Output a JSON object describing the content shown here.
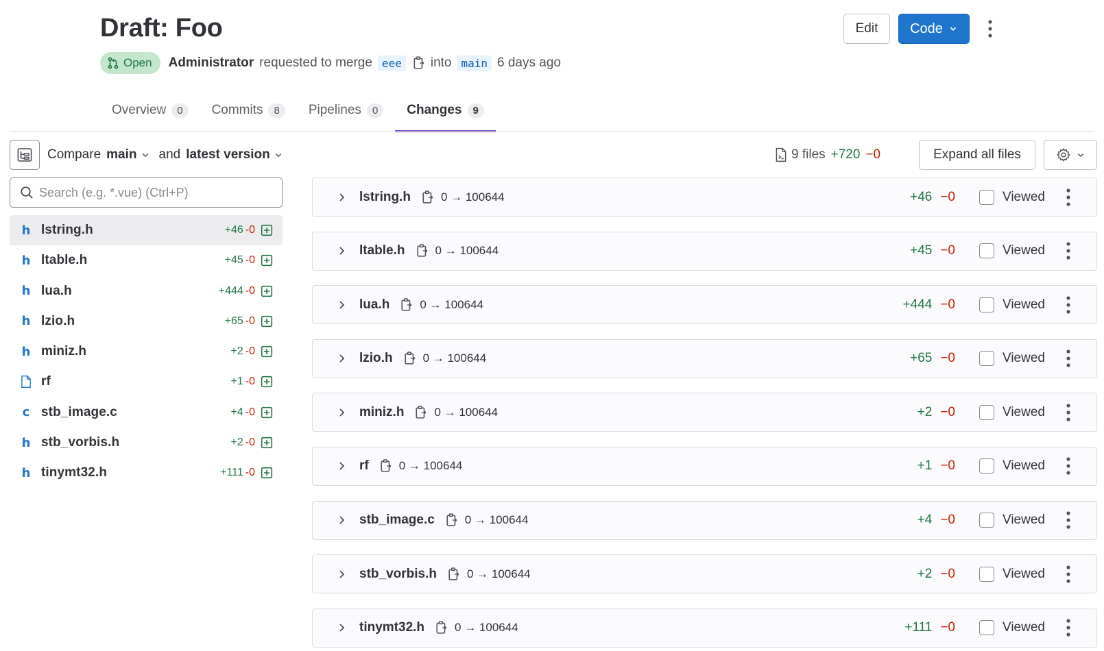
{
  "header": {
    "title": "Draft: Foo",
    "status": "Open",
    "author": "Administrator",
    "action": "requested to merge",
    "source_branch": "eee",
    "into": "into",
    "target_branch": "main",
    "time": "6 days ago",
    "edit_label": "Edit",
    "code_label": "Code"
  },
  "tabs": [
    {
      "label": "Overview",
      "count": "0"
    },
    {
      "label": "Commits",
      "count": "8"
    },
    {
      "label": "Pipelines",
      "count": "0"
    },
    {
      "label": "Changes",
      "count": "9"
    }
  ],
  "toolbar": {
    "compare_label": "Compare",
    "base": "main",
    "and_label": "and",
    "head": "latest version",
    "files_count": "9 files",
    "added_total": "+720",
    "removed_total": "−0",
    "expand_label": "Expand all files"
  },
  "search": {
    "placeholder": "Search (e.g. *.vue) (Ctrl+P)"
  },
  "tree": [
    {
      "icon": "h",
      "name": "lstring.h",
      "added": "+46",
      "removed": "-0"
    },
    {
      "icon": "h",
      "name": "ltable.h",
      "added": "+45",
      "removed": "-0"
    },
    {
      "icon": "h",
      "name": "lua.h",
      "added": "+444",
      "removed": "-0"
    },
    {
      "icon": "h",
      "name": "lzio.h",
      "added": "+65",
      "removed": "-0"
    },
    {
      "icon": "h",
      "name": "miniz.h",
      "added": "+2",
      "removed": "-0"
    },
    {
      "icon": "file",
      "name": "rf",
      "added": "+1",
      "removed": "-0"
    },
    {
      "icon": "c",
      "name": "stb_image.c",
      "added": "+4",
      "removed": "-0"
    },
    {
      "icon": "h",
      "name": "stb_vorbis.h",
      "added": "+2",
      "removed": "-0"
    },
    {
      "icon": "h",
      "name": "tinymt32.h",
      "added": "+111",
      "removed": "-0"
    }
  ],
  "files": [
    {
      "name": "lstring.h",
      "mode": "0 → 100644",
      "added": "+46",
      "removed": "−0",
      "viewed_label": "Viewed"
    },
    {
      "name": "ltable.h",
      "mode": "0 → 100644",
      "added": "+45",
      "removed": "−0",
      "viewed_label": "Viewed"
    },
    {
      "name": "lua.h",
      "mode": "0 → 100644",
      "added": "+444",
      "removed": "−0",
      "viewed_label": "Viewed"
    },
    {
      "name": "lzio.h",
      "mode": "0 → 100644",
      "added": "+65",
      "removed": "−0",
      "viewed_label": "Viewed"
    },
    {
      "name": "miniz.h",
      "mode": "0 → 100644",
      "added": "+2",
      "removed": "−0",
      "viewed_label": "Viewed"
    },
    {
      "name": "rf",
      "mode": "0 → 100644",
      "added": "+1",
      "removed": "−0",
      "viewed_label": "Viewed"
    },
    {
      "name": "stb_image.c",
      "mode": "0 → 100644",
      "added": "+4",
      "removed": "−0",
      "viewed_label": "Viewed"
    },
    {
      "name": "stb_vorbis.h",
      "mode": "0 → 100644",
      "added": "+2",
      "removed": "−0",
      "viewed_label": "Viewed"
    },
    {
      "name": "tinymt32.h",
      "mode": "0 → 100644",
      "added": "+111",
      "removed": "−0",
      "viewed_label": "Viewed"
    }
  ],
  "colors": {
    "accent": "#1f75cb",
    "tab_active": "#6e49cb",
    "added": "#217645",
    "removed": "#c91c00",
    "open_badge_bg": "#c3e6cd"
  }
}
